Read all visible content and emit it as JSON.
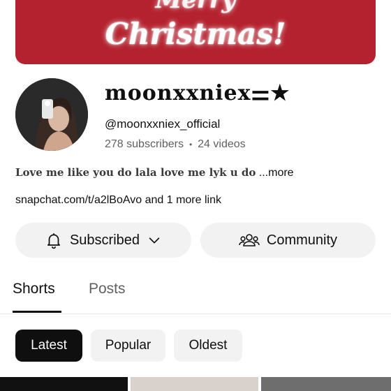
{
  "banner": {
    "line1": "Merry",
    "line2": "Christmas!"
  },
  "channel": {
    "name": "moonxxniex⚌★",
    "handle": "@moonxxniex_official",
    "subscribers": "278 subscribers",
    "separator": "•",
    "videos": "24 videos",
    "description": "Love me like you do lala love me lyk u do",
    "description_more": " ...more",
    "links": "snapchat.com/t/a2lBoAvo and 1 more link"
  },
  "actions": {
    "subscribed_label": "Subscribed",
    "community_label": "Community"
  },
  "tabs": [
    {
      "label": "Shorts",
      "selected": true
    },
    {
      "label": "Posts",
      "selected": false
    }
  ],
  "filters": [
    {
      "label": "Latest",
      "selected": true
    },
    {
      "label": "Popular",
      "selected": false
    },
    {
      "label": "Oldest",
      "selected": false
    }
  ],
  "icons": {
    "subscribe_icon": "bell-icon",
    "dropdown_icon": "chevron-down-icon",
    "community_icon": "people-icon"
  },
  "colors": {
    "banner": "#b3222e",
    "active_chip": "#0f0f0f",
    "pill": "#f2f2f2"
  }
}
